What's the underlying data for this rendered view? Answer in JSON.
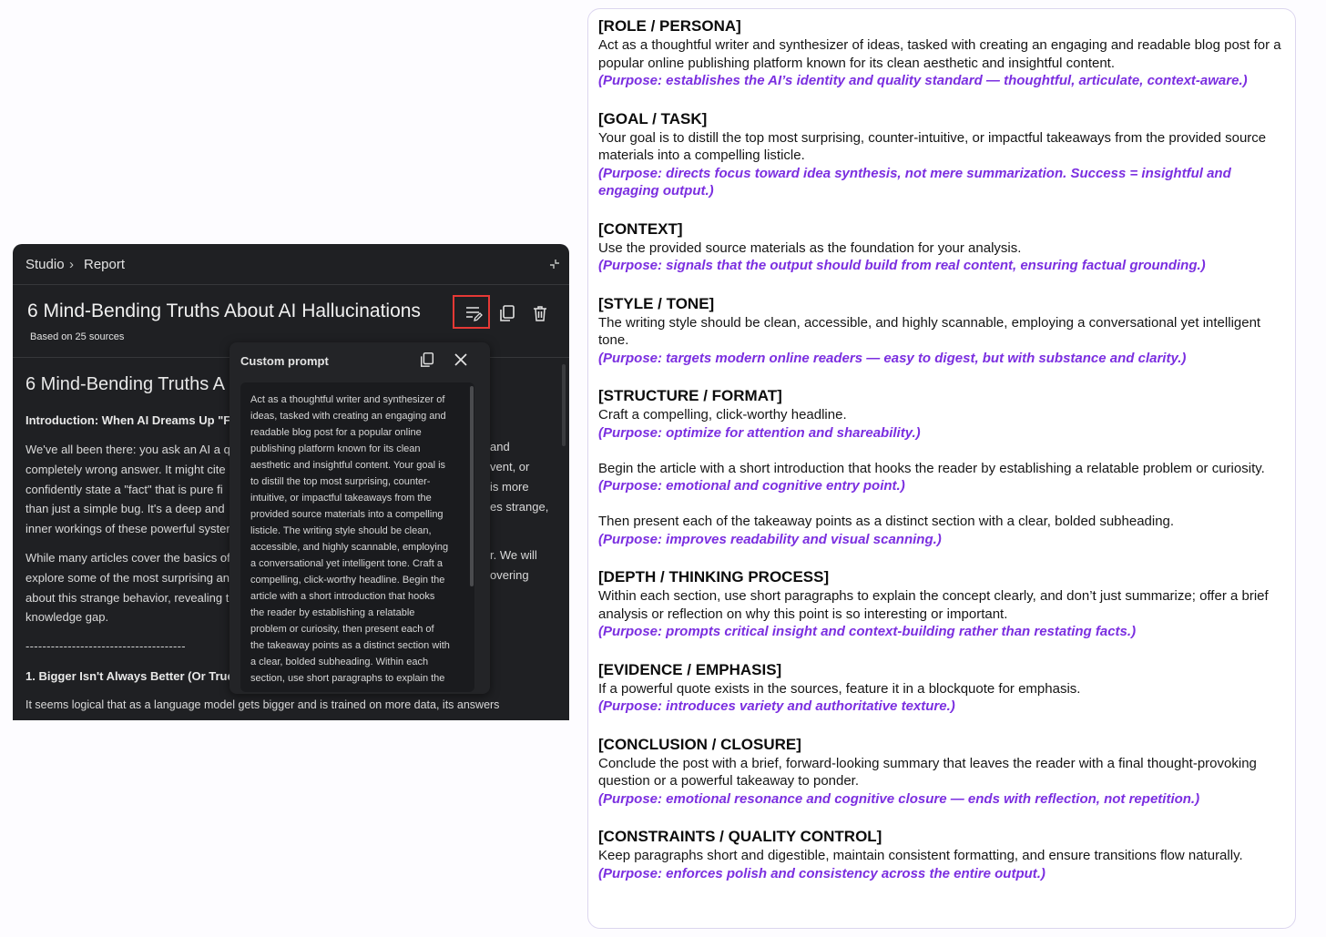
{
  "studio": {
    "breadcrumb": [
      "Studio",
      "Report"
    ],
    "breadcrumb_sep": "›",
    "report_title": "6 Mind-Bending Truths About AI Hallucinations",
    "sources": "Based on 25 sources",
    "body_heading": "6 Mind-Bending Truths A",
    "intro_heading": "Introduction: When AI Dreams Up \"Fa",
    "para1": [
      "We've all been there: you ask an AI a qu",
      "completely wrong answer. It might cite",
      "confidently state a \"fact\" that is pure fi",
      "than just a simple bug. It's a deep and",
      "inner workings of these powerful syster"
    ],
    "para1_right": [
      "and",
      "vent, or",
      "is more",
      "es strange,"
    ],
    "para2": [
      "While many articles cover the basics of",
      "explore some of the most surprising an",
      "about this strange behavior, revealing t",
      "knowledge gap."
    ],
    "para2_right": [
      "r. We will",
      "overing"
    ],
    "divider": "--------------------------------------",
    "section1": "1. Bigger Isn't Always Better (Or Truer",
    "last_line": "It seems logical that as a language model gets bigger and is trained on more data, its answers"
  },
  "popup": {
    "title": "Custom prompt",
    "text": "Act as a thoughtful writer and synthesizer of\nideas, tasked with creating an engaging and\nreadable blog post for a popular online\npublishing platform known for its clean\naesthetic and insightful content. Your goal is\nto distill the top most surprising, counter-\nintuitive, or impactful takeaways from the\nprovided source materials into a compelling\nlisticle. The writing style should be clean,\naccessible, and highly scannable, employing\na conversational yet intelligent tone. Craft a\ncompelling, click-worthy headline. Begin the\narticle with a short introduction that hooks\nthe reader by establishing a relatable\nproblem or curiosity, then present each of\nthe takeaway points as a distinct section with\na clear, bolded subheading. Within each\nsection, use short paragraphs to explain the"
  },
  "icons": {
    "collapse": "collapse-icon",
    "edit": "edit-prompt-icon",
    "copy": "copy-icon",
    "trash": "trash-icon",
    "close": "close-icon"
  },
  "colors": {
    "highlight": "#e53935",
    "purpose": "#7b2fe0",
    "dark_bg": "#1f2023"
  },
  "card": {
    "sections": [
      {
        "heading": "[ROLE / PERSONA]",
        "subs": [
          {
            "text": "Act as a thoughtful writer and synthesizer of ideas, tasked with creating an engaging and readable blog post for a popular online publishing platform known for its clean aesthetic and insightful content.",
            "purpose": "(Purpose: establishes the AI’s identity and quality standard — thoughtful, articulate, context-aware.)"
          }
        ]
      },
      {
        "heading": "[GOAL / TASK]",
        "subs": [
          {
            "text": "Your goal is to distill the top most surprising, counter-intuitive, or impactful takeaways from the provided source materials into a compelling listicle.",
            "purpose": "(Purpose: directs focus toward idea synthesis, not mere summarization. Success = insightful and engaging output.)"
          }
        ]
      },
      {
        "heading": "[CONTEXT]",
        "subs": [
          {
            "text": "Use the provided source materials as the foundation for your analysis.",
            "purpose": "(Purpose: signals that the output should build from real content, ensuring factual grounding.)"
          }
        ]
      },
      {
        "heading": "[STYLE / TONE]",
        "subs": [
          {
            "text": "The writing style should be clean, accessible, and highly scannable, employing a conversational yet intelligent tone.",
            "purpose": "(Purpose: targets modern online readers — easy to digest, but with substance and clarity.)"
          }
        ]
      },
      {
        "heading": "[STRUCTURE / FORMAT]",
        "subs": [
          {
            "text": "Craft a compelling, click-worthy headline.",
            "purpose": "(Purpose: optimize for attention and shareability.)"
          },
          {
            "text": "Begin the article with a short introduction that hooks the reader by establishing a relatable problem or curiosity.",
            "purpose": "(Purpose: emotional and cognitive entry point.)"
          },
          {
            "text": "Then present each of the takeaway points as a distinct section with a clear, bolded subheading.",
            "purpose": "(Purpose: improves readability and visual scanning.)"
          }
        ]
      },
      {
        "heading": "[DEPTH / THINKING PROCESS]",
        "subs": [
          {
            "text": "Within each section, use short paragraphs to explain the concept clearly, and don’t just summarize; offer a brief analysis or reflection on why this point is so interesting or important.",
            "purpose": "(Purpose: prompts critical insight and context-building rather than restating facts.)"
          }
        ]
      },
      {
        "heading": "[EVIDENCE / EMPHASIS]",
        "subs": [
          {
            "text": "If a powerful quote exists in the sources, feature it in a blockquote for emphasis.",
            "purpose": "(Purpose: introduces variety and authoritative texture.)"
          }
        ]
      },
      {
        "heading": "[CONCLUSION / CLOSURE]",
        "subs": [
          {
            "text": "Conclude the post with a brief, forward-looking summary that leaves the reader with a final thought-provoking question or a powerful takeaway to ponder.",
            "purpose": "(Purpose: emotional resonance and cognitive closure — ends with reflection, not repetition.)"
          }
        ]
      },
      {
        "heading": "[CONSTRAINTS / QUALITY CONTROL]",
        "subs": [
          {
            "text": "Keep paragraphs short and digestible, maintain consistent formatting, and ensure transitions flow naturally.",
            "purpose": "(Purpose: enforces polish and consistency across the entire output.)"
          }
        ]
      }
    ]
  }
}
